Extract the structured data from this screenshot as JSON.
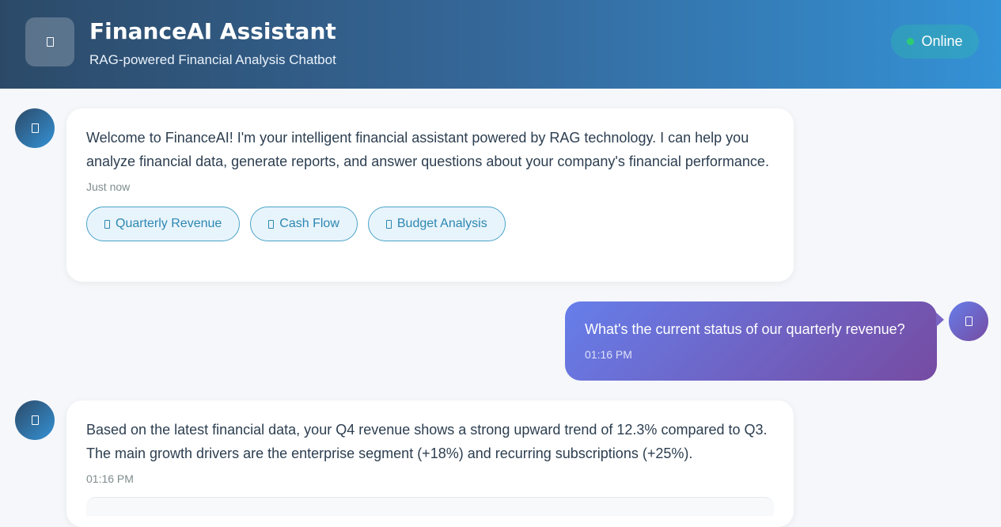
{
  "header": {
    "logo_icon": "chat-bot-icon",
    "title": "FinanceAI Assistant",
    "subtitle": "RAG-powered Financial Analysis Chatbot",
    "status": "Online",
    "status_color": "#2ecc71",
    "gradient": [
      "#2c4a68",
      "#3492d6"
    ]
  },
  "messages": [
    {
      "role": "bot",
      "avatar_icon": "bot-icon",
      "text": "Welcome to FinanceAI! I'm your intelligent financial assistant powered by RAG technology. I can help you analyze financial data, generate reports, and answer questions about your company's financial performance.",
      "time": "Just now",
      "quick_actions": [
        {
          "icon": "chart-icon",
          "label": "Quarterly Revenue"
        },
        {
          "icon": "money-icon",
          "label": "Cash Flow"
        },
        {
          "icon": "clipboard-icon",
          "label": "Budget Analysis"
        }
      ]
    },
    {
      "role": "user",
      "avatar_icon": "user-icon",
      "text": "What's the current status of our quarterly revenue?",
      "time": "01:16 PM",
      "gradient": [
        "#667eea",
        "#764ba2"
      ]
    },
    {
      "role": "bot",
      "avatar_icon": "bot-icon",
      "text": "Based on the latest financial data, your Q4 revenue shows a strong upward trend of 12.3% compared to Q3. The main growth drivers are the enterprise segment (+18%) and recurring subscriptions (+25%).",
      "time": "01:16 PM"
    }
  ]
}
